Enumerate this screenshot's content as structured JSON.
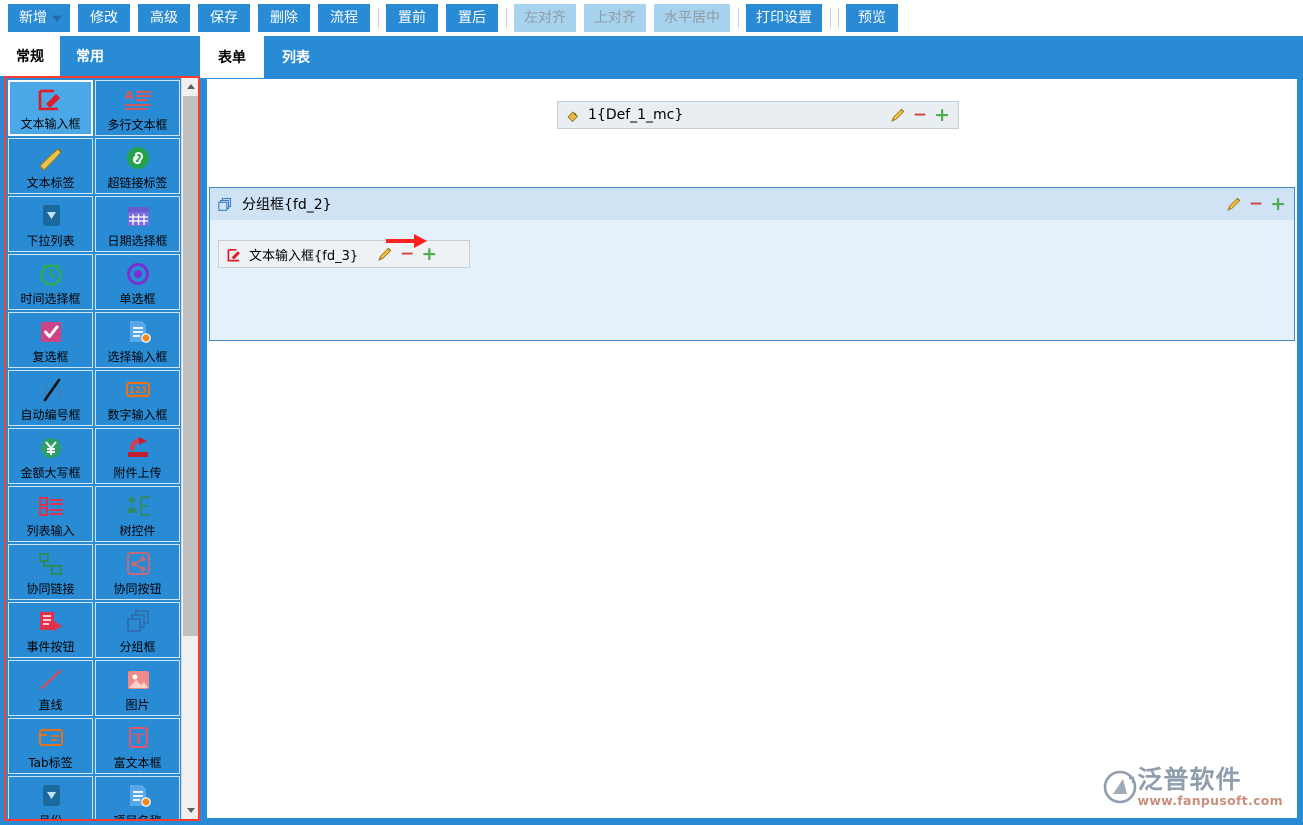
{
  "toolbar": {
    "buttons": [
      {
        "label": "新增",
        "name": "new-button",
        "state": "enabled",
        "dropdown": true
      },
      {
        "label": "修改",
        "name": "edit-button",
        "state": "enabled",
        "dropdown": false
      },
      {
        "label": "高级",
        "name": "advanced-button",
        "state": "enabled",
        "dropdown": false
      },
      {
        "label": "保存",
        "name": "save-button",
        "state": "enabled",
        "dropdown": false
      },
      {
        "label": "删除",
        "name": "delete-button",
        "state": "enabled",
        "dropdown": false
      },
      {
        "label": "流程",
        "name": "workflow-button",
        "state": "enabled",
        "dropdown": false
      },
      {
        "label": "置前",
        "name": "bring-front-button",
        "state": "enabled",
        "dropdown": false
      },
      {
        "label": "置后",
        "name": "send-back-button",
        "state": "enabled",
        "dropdown": false
      },
      {
        "label": "左对齐",
        "name": "align-left-button",
        "state": "disabled",
        "dropdown": false
      },
      {
        "label": "上对齐",
        "name": "align-top-button",
        "state": "disabled",
        "dropdown": false
      },
      {
        "label": "水平居中",
        "name": "align-center-horizontal-button",
        "state": "disabled",
        "dropdown": false
      },
      {
        "label": "打印设置",
        "name": "print-settings-button",
        "state": "enabled",
        "dropdown": false
      },
      {
        "label": "预览",
        "name": "preview-button",
        "state": "enabled",
        "dropdown": false
      }
    ],
    "colors": {
      "enabled_bg": "#2a8bd5",
      "disabled_bg": "#a8d3ef",
      "enabled_text": "#ffffff",
      "disabled_text": "#8e9ba5"
    }
  },
  "sidebar": {
    "tabs": [
      {
        "label": "常规",
        "active": true
      },
      {
        "label": "常用",
        "active": false
      }
    ],
    "palette": [
      {
        "label": "文本输入框",
        "icon": "text-input-icon",
        "selected": true
      },
      {
        "label": "多行文本框",
        "icon": "multiline-text-icon",
        "selected": false
      },
      {
        "label": "文本标签",
        "icon": "text-label-icon",
        "selected": false
      },
      {
        "label": "超链接标签",
        "icon": "hyperlink-icon",
        "selected": false
      },
      {
        "label": "下拉列表",
        "icon": "dropdown-icon",
        "selected": false
      },
      {
        "label": "日期选择框",
        "icon": "calendar-icon",
        "selected": false
      },
      {
        "label": "时间选择框",
        "icon": "clock-icon",
        "selected": false
      },
      {
        "label": "单选框",
        "icon": "radio-icon",
        "selected": false
      },
      {
        "label": "复选框",
        "icon": "checkbox-icon",
        "selected": false
      },
      {
        "label": "选择输入框",
        "icon": "select-input-icon",
        "selected": false
      },
      {
        "label": "自动编号框",
        "icon": "auto-number-icon",
        "selected": false
      },
      {
        "label": "数字输入框",
        "icon": "number-input-icon",
        "selected": false
      },
      {
        "label": "金额大写框",
        "icon": "currency-icon",
        "selected": false
      },
      {
        "label": "附件上传",
        "icon": "upload-icon",
        "selected": false
      },
      {
        "label": "列表输入",
        "icon": "list-input-icon",
        "selected": false
      },
      {
        "label": "树控件",
        "icon": "tree-icon",
        "selected": false
      },
      {
        "label": "协同链接",
        "icon": "collaborate-link-icon",
        "selected": false
      },
      {
        "label": "协同按钮",
        "icon": "collaborate-button-icon",
        "selected": false
      },
      {
        "label": "事件按钮",
        "icon": "event-button-icon",
        "selected": false
      },
      {
        "label": "分组框",
        "icon": "groupbox-icon",
        "selected": false
      },
      {
        "label": "直线",
        "icon": "line-icon",
        "selected": false
      },
      {
        "label": "图片",
        "icon": "image-icon",
        "selected": false
      },
      {
        "label": "Tab标签",
        "icon": "tab-label-icon",
        "selected": false
      },
      {
        "label": "富文本框",
        "icon": "rich-text-icon",
        "selected": false
      },
      {
        "label": "月份",
        "icon": "month-icon",
        "selected": false
      },
      {
        "label": "项目名称",
        "icon": "project-name-icon",
        "selected": false
      }
    ],
    "scrollbar": {
      "up_arrow": "scroll-up-icon",
      "down_arrow": "scroll-down-icon"
    }
  },
  "main": {
    "tabs": [
      {
        "label": "表单",
        "active": true
      },
      {
        "label": "列表",
        "active": false
      }
    ],
    "form": {
      "def_chip": {
        "label": "1{Def_1_mc}",
        "actions": {
          "edit": "pencil-icon",
          "remove": "−",
          "add": "+"
        }
      },
      "groupbox": {
        "label": "分组框{fd_2}",
        "actions": {
          "edit": "pencil-icon",
          "remove": "−",
          "add": "+"
        },
        "children": [
          {
            "label": "文本输入框{fd_3}",
            "icon": "text-input-icon",
            "actions": {
              "edit": "pencil-icon",
              "remove": "−",
              "add": "+"
            },
            "annotated": true
          }
        ]
      }
    }
  },
  "watermark": {
    "name": "泛普软件",
    "url": "www.fanpusoft.com"
  }
}
